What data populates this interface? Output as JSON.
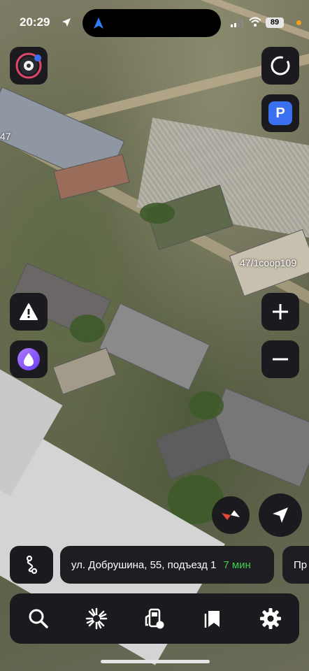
{
  "status_bar": {
    "time": "20:29",
    "battery": "89"
  },
  "map": {
    "label_left": "47",
    "label_right": "47/1соор109"
  },
  "route": {
    "address": "ул. Добрушина, 55, подъезд 1",
    "eta": "7 мин",
    "next_card_text": "Пр"
  },
  "buttons": {
    "parking_label": "P"
  },
  "tabs": [
    {
      "name": "search",
      "icon": "search-icon"
    },
    {
      "name": "discover",
      "icon": "sparkle-icon"
    },
    {
      "name": "fuel",
      "icon": "fuel-icon"
    },
    {
      "name": "bookmarks",
      "icon": "bookmark-icon"
    },
    {
      "name": "settings",
      "icon": "gear-icon"
    }
  ],
  "colors": {
    "eta_green": "#3ccf4e",
    "panel_dark": "#1b1b1f",
    "parking_blue": "#3a6ff0",
    "compass_red": "#e8443a"
  }
}
